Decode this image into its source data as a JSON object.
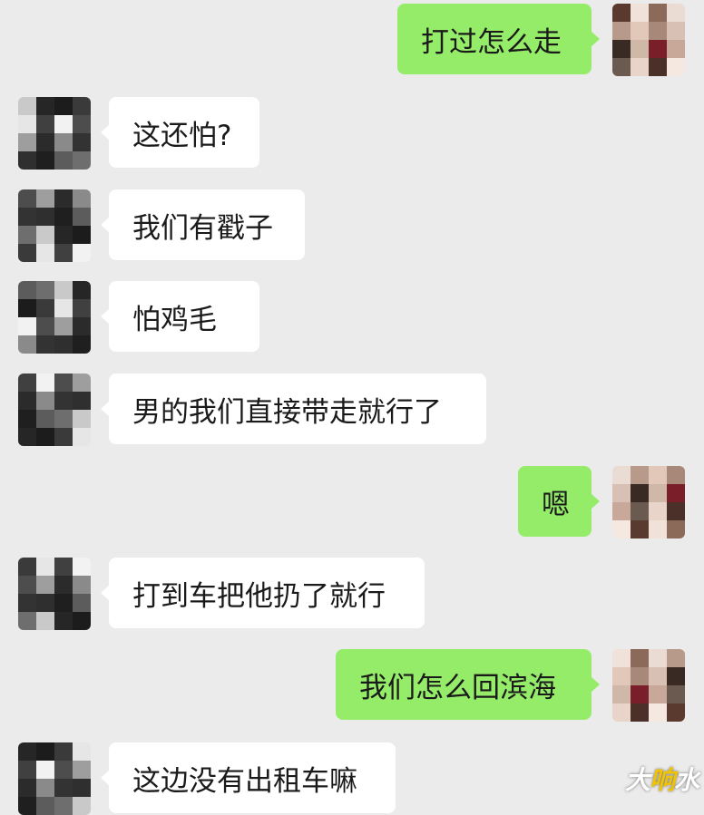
{
  "messages": [
    {
      "side": "right",
      "text": "打过怎么走",
      "avatar": "avatar-b"
    },
    {
      "side": "left",
      "text": "这还怕?",
      "avatar": "avatar-a"
    },
    {
      "side": "left",
      "text": "我们有戳子",
      "avatar": "avatar-a"
    },
    {
      "side": "left",
      "text": "怕鸡毛",
      "avatar": "avatar-a"
    },
    {
      "side": "left",
      "text": "男的我们直接带走就行了",
      "avatar": "avatar-a"
    },
    {
      "side": "right",
      "text": "嗯",
      "avatar": "avatar-b"
    },
    {
      "side": "left",
      "text": "打到车把他扔了就行",
      "avatar": "avatar-a"
    },
    {
      "side": "right",
      "text": "我们怎么回滨海",
      "avatar": "avatar-b"
    },
    {
      "side": "left",
      "text": "这边没有出租车嘛",
      "avatar": "avatar-a"
    }
  ],
  "watermark": {
    "text": "大响水"
  },
  "colors": {
    "background": "#ebebeb",
    "incoming_bubble": "#ffffff",
    "outgoing_bubble": "#95ec69",
    "text": "#1a1a1a"
  }
}
